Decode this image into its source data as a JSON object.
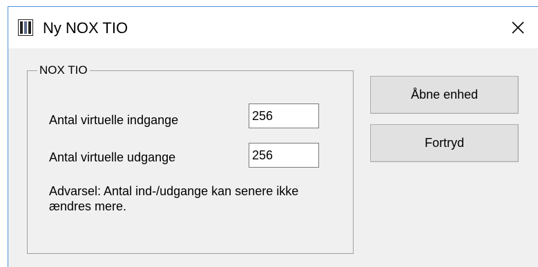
{
  "window": {
    "title": "Ny NOX TIO",
    "close_symbol": "✕"
  },
  "group": {
    "legend": "NOX TIO",
    "fields": [
      {
        "label": "Antal virtuelle indgange",
        "value": "256"
      },
      {
        "label": "Antal virtuelle udgange",
        "value": "256"
      }
    ],
    "warning": "Advarsel: Antal ind-/udgange kan senere ikke ændres mere."
  },
  "buttons": {
    "open_label": "Åbne enhed",
    "cancel_label": "Fortryd"
  },
  "icons": {
    "app": "app-icon",
    "close": "close-icon"
  }
}
